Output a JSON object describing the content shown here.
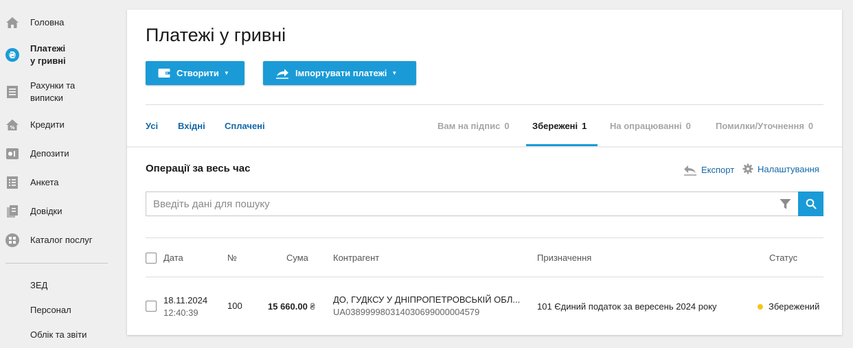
{
  "sidebar": {
    "items": [
      {
        "label": "Головна",
        "icon": "home-icon"
      },
      {
        "label": "Платежі",
        "label2": "у гривні",
        "icon": "hryvnia-icon"
      },
      {
        "label": "Рахунки та",
        "label2": "виписки",
        "icon": "statement-icon"
      },
      {
        "label": "Кредити",
        "icon": "credit-icon"
      },
      {
        "label": "Депозити",
        "icon": "deposit-icon"
      },
      {
        "label": "Анкета",
        "icon": "form-icon"
      },
      {
        "label": "Довідки",
        "icon": "docs-icon"
      },
      {
        "label": "Каталог послуг",
        "icon": "catalog-icon"
      }
    ],
    "sub_items": [
      "ЗЕД",
      "Персонал",
      "Облік та звіти"
    ]
  },
  "main": {
    "title": "Платежі у гривні",
    "create_label": "Створити",
    "import_label": "Імпортувати платежі",
    "tabs_left": [
      "Усі",
      "Вхідні",
      "Сплачені"
    ],
    "tabs_right": [
      {
        "label": "Вам на підпис",
        "count": "0"
      },
      {
        "label": "Збережені",
        "count": "1"
      },
      {
        "label": "На опрацюванні",
        "count": "0"
      },
      {
        "label": "Помилки/Уточнення",
        "count": "0"
      }
    ],
    "ops_title": "Операції за весь час",
    "export_label": "Експорт",
    "settings_label": "Налаштування",
    "search_placeholder": "Введіть дані для пошуку"
  },
  "table": {
    "headers": {
      "date": "Дата",
      "num": "№",
      "sum": "Сума",
      "counterparty": "Контрагент",
      "purpose": "Призначення",
      "status": "Статус"
    },
    "rows": [
      {
        "date": "18.11.2024",
        "time": "12:40:39",
        "num": "100",
        "sum": "15 660.00",
        "currency": "₴",
        "counterparty": "ДО, ГУДКСУ У ДНІПРОПЕТРОВСЬКІЙ ОБЛ...",
        "iban": "UA038999980314030699000004579",
        "purpose": "101 Єдиний податок за вересень 2024 року",
        "status": "Збережений"
      }
    ]
  },
  "colors": {
    "accent": "#1a9bd7",
    "link": "#1468a8",
    "status_saved": "#f5c518"
  }
}
